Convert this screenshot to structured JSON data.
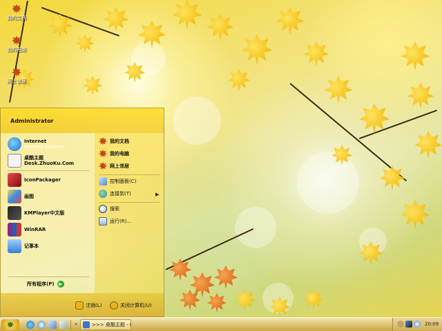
{
  "desktop": {
    "icons": [
      {
        "label": "我的文档",
        "icon": "my-documents-icon"
      },
      {
        "label": "我的电脑",
        "icon": "my-computer-icon"
      },
      {
        "label": "网上邻居",
        "icon": "network-places-icon"
      }
    ]
  },
  "start_menu": {
    "user": "Administrator",
    "pinned": [
      {
        "title": "Internet",
        "subtitle": "Internet Explorer",
        "icon": "internet-explorer-icon"
      },
      {
        "title": "桌酷主题",
        "subtitle": "Desk.ZhuoKu.Com",
        "icon": "zhuoku-theme-icon"
      }
    ],
    "recent": [
      {
        "title": "IconPackager",
        "icon": "iconpackager-icon"
      },
      {
        "title": "画图",
        "icon": "paint-icon"
      },
      {
        "title": "KMPlayer中文版",
        "icon": "kmplayer-icon"
      },
      {
        "title": "WinRAR",
        "icon": "winrar-icon"
      },
      {
        "title": "记事本",
        "icon": "notepad-icon"
      }
    ],
    "all_programs": "所有程序(P)",
    "places": [
      {
        "title": "我的文档",
        "icon": "my-documents-icon"
      },
      {
        "title": "我的电脑",
        "icon": "my-computer-icon"
      },
      {
        "title": "网上邻居",
        "icon": "network-places-icon"
      }
    ],
    "system": [
      {
        "title": "控制面板(C)",
        "icon": "control-panel-icon"
      },
      {
        "title": "连接到(T)",
        "icon": "connect-to-icon"
      }
    ],
    "tools": [
      {
        "title": "搜索",
        "icon": "search-icon"
      },
      {
        "title": "运行(R)...",
        "icon": "run-icon"
      }
    ],
    "footer": {
      "logoff": "注销(L)",
      "shutdown": "关闭计算机(U)"
    }
  },
  "taskbar": {
    "chevron": "»",
    "task_label": ">>> 桌酷主题 - Mic...",
    "clock": "20:09"
  },
  "colors": {
    "taskbar": "#e0c87a",
    "start_button": "#d39a10",
    "accent_green": "#2aa62a"
  }
}
